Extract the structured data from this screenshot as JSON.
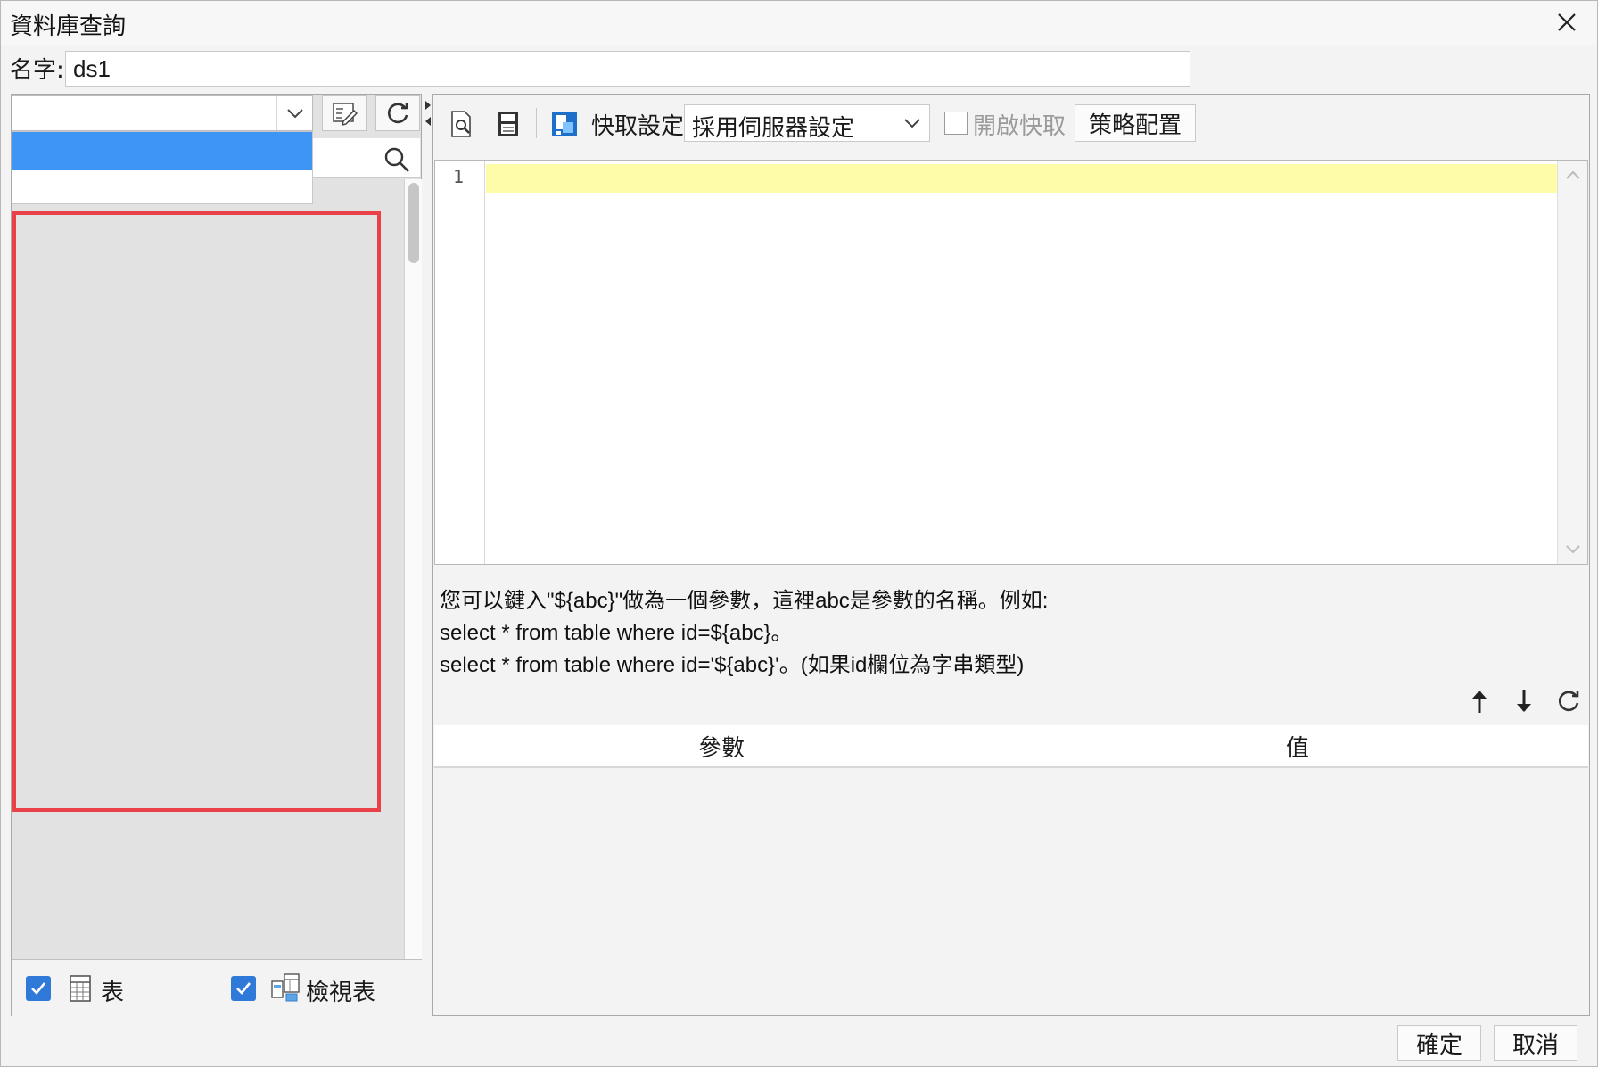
{
  "window": {
    "title": "資料庫查詢"
  },
  "name_row": {
    "label": "名字:",
    "value": "ds1"
  },
  "left": {
    "type_filters": [
      {
        "label": "表",
        "checked": true
      },
      {
        "label": "檢視表",
        "checked": true
      }
    ]
  },
  "toolbar": {
    "cache_label": "快取設定",
    "cache_value": "採用伺服器設定",
    "enable_cache_label": "開啟快取",
    "strategy_button": "策略配置"
  },
  "editor": {
    "line_numbers": [
      "1"
    ]
  },
  "hint": {
    "line1": "您可以鍵入\"${abc}\"做為一個參數，這裡abc是參數的名稱。例如:",
    "line2": "select * from table where id=${abc}。",
    "line3": "select * from table where id='${abc}'。(如果id欄位為字串類型)"
  },
  "params": {
    "col_param": "參數",
    "col_value": "值"
  },
  "footer": {
    "ok": "確定",
    "cancel": "取消"
  },
  "colors": {
    "selection": "#3e95f5",
    "highlight_border": "#ea4148",
    "current_line": "#fefba9",
    "checkbox": "#2f7ad8"
  }
}
